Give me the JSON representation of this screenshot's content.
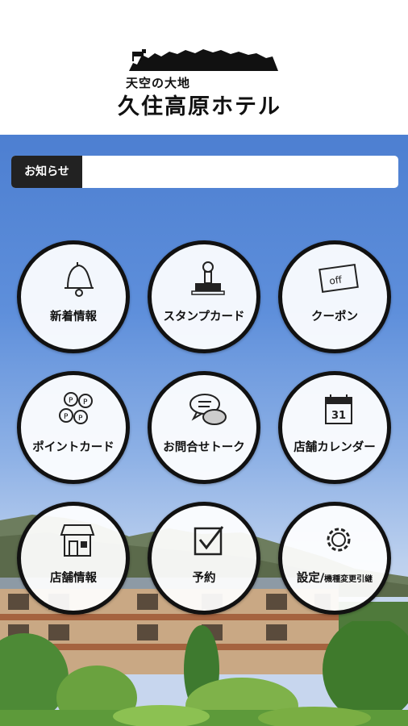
{
  "logo": {
    "tagline": "天空の大地",
    "name": "久住高原ホテル"
  },
  "notice": {
    "label": "お知らせ",
    "text": ""
  },
  "menu": [
    {
      "label": "新着情報",
      "icon": "bell-icon"
    },
    {
      "label": "スタンプカード",
      "icon": "stamp-icon"
    },
    {
      "label": "クーポン",
      "icon": "coupon-icon"
    },
    {
      "label": "ポイントカード",
      "icon": "points-icon"
    },
    {
      "label": "お問合せトーク",
      "icon": "chat-icon"
    },
    {
      "label": "店舗カレンダー",
      "icon": "calendar-icon"
    },
    {
      "label": "店舗情報",
      "icon": "store-icon"
    },
    {
      "label": "予約",
      "icon": "checkbox-icon"
    },
    {
      "label": "設定/",
      "sublabel": "機種変更引継",
      "icon": "gear-icon"
    }
  ],
  "calendar_day": "31"
}
